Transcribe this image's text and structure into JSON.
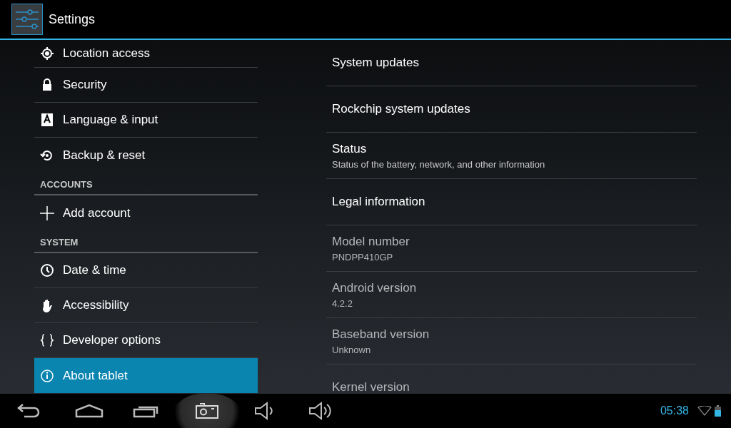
{
  "action_bar": {
    "title": "Settings"
  },
  "sidebar": {
    "items": [
      {
        "kind": "item",
        "label": "Location access",
        "selected": false
      },
      {
        "kind": "item",
        "label": "Security",
        "selected": false
      },
      {
        "kind": "item",
        "label": "Language & input",
        "selected": false
      },
      {
        "kind": "item",
        "label": "Backup & reset",
        "selected": false
      },
      {
        "kind": "header",
        "label": "ACCOUNTS"
      },
      {
        "kind": "item",
        "label": "Add account",
        "selected": false
      },
      {
        "kind": "header",
        "label": "SYSTEM"
      },
      {
        "kind": "item",
        "label": "Date & time",
        "selected": false
      },
      {
        "kind": "item",
        "label": "Accessibility",
        "selected": false
      },
      {
        "kind": "item",
        "label": "Developer options",
        "selected": false
      },
      {
        "kind": "item",
        "label": "About tablet",
        "selected": true
      }
    ]
  },
  "details": [
    {
      "title": "System updates",
      "disabled": false
    },
    {
      "title": "Rockchip system updates",
      "disabled": false
    },
    {
      "title": "Status",
      "summary": "Status of the battery, network, and other information",
      "disabled": false
    },
    {
      "title": "Legal information",
      "disabled": false
    },
    {
      "title": "Model number",
      "summary": "PNDPP410GP",
      "disabled": true
    },
    {
      "title": "Android version",
      "summary": "4.2.2",
      "disabled": true
    },
    {
      "title": "Baseband version",
      "summary": "Unknown",
      "disabled": true
    },
    {
      "title": "Kernel version",
      "disabled": true
    }
  ],
  "status_bar": {
    "time": "05:38"
  }
}
